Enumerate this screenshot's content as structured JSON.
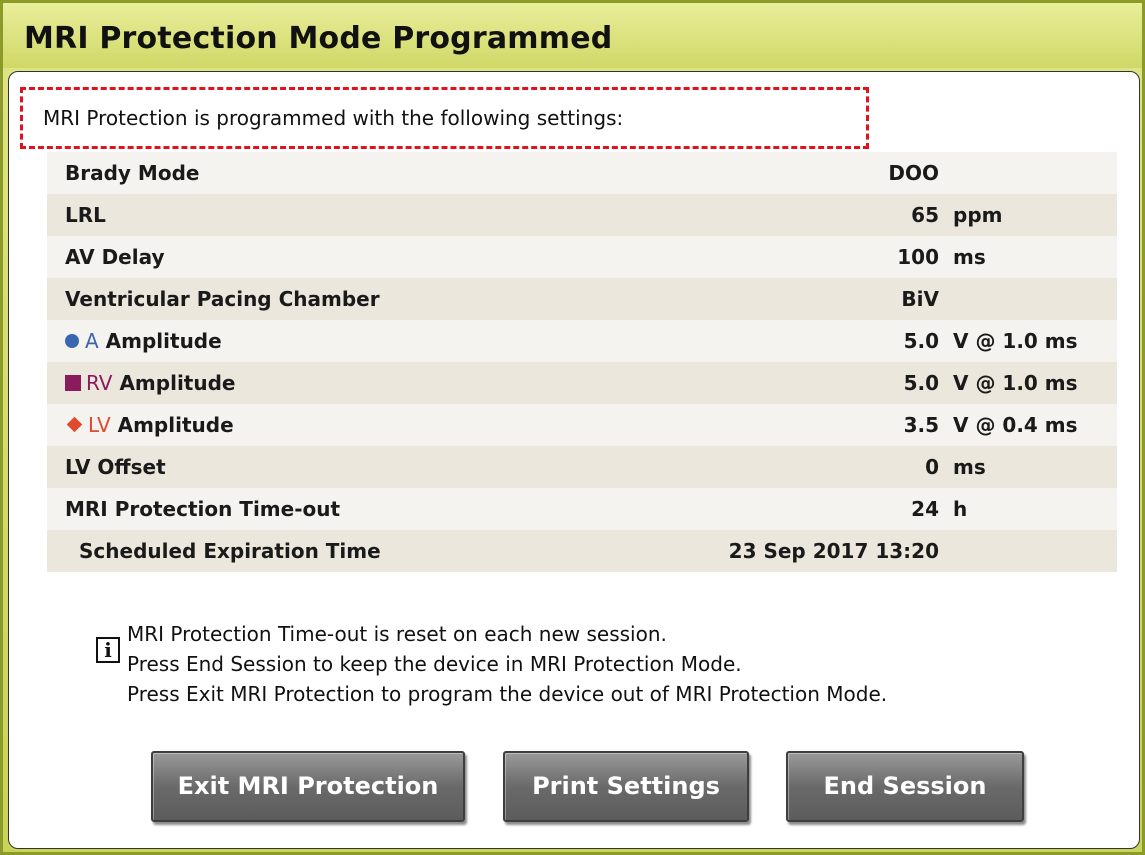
{
  "dialog": {
    "title": "MRI Protection Mode Programmed",
    "intro": "MRI Protection is programmed with the following settings:"
  },
  "settings": [
    {
      "label": "Brady Mode",
      "value": "DOO",
      "unit": ""
    },
    {
      "label": "LRL",
      "value": "65",
      "unit": "ppm"
    },
    {
      "label": "AV Delay",
      "value": "100",
      "unit": "ms"
    },
    {
      "label": "Ventricular Pacing Chamber",
      "value": "BiV",
      "unit": ""
    },
    {
      "label_prefix": "A",
      "label": "Amplitude",
      "value": "5.0",
      "unit": "V @ 1.0 ms",
      "symbol": "circle-icon"
    },
    {
      "label_prefix": "RV",
      "label": "Amplitude",
      "value": "5.0",
      "unit": "V @ 1.0 ms",
      "symbol": "square-icon"
    },
    {
      "label_prefix": "LV",
      "label": "Amplitude",
      "value": "3.5",
      "unit": "V @ 0.4 ms",
      "symbol": "diamond-icon"
    },
    {
      "label": "LV Offset",
      "value": "0",
      "unit": "ms"
    },
    {
      "label": "MRI Protection Time-out",
      "value": "24",
      "unit": "h"
    },
    {
      "label": "Scheduled Expiration Time",
      "value": "23 Sep 2017 13:20",
      "unit": ""
    }
  ],
  "info": {
    "icon": "info-icon",
    "lines": [
      "MRI Protection Time-out is reset on each new session.",
      "Press End Session to keep the device in MRI Protection Mode.",
      "Press Exit MRI Protection to program the device out of MRI Protection Mode."
    ]
  },
  "buttons": {
    "exit": "Exit MRI Protection",
    "print": "Print Settings",
    "end": "End Session"
  },
  "colors": {
    "titlebar": "#d6dd74",
    "highlight_border": "#e0121e",
    "a_channel": "#3a66b0",
    "rv_channel": "#8a1c5e",
    "lv_channel": "#e04b2e"
  }
}
